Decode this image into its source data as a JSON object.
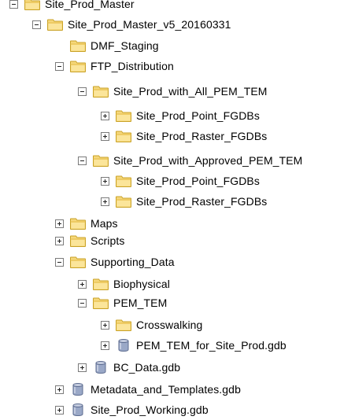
{
  "colors": {
    "text": "#000000",
    "toggle_border": "#7a7a7a",
    "folder_fill": "#f5d77a",
    "folder_stroke": "#c9a227",
    "database_fill": "#9aa8c7",
    "database_stroke": "#5c6b8f"
  },
  "tree": [
    {
      "label": "Site_Prod_Master",
      "icon": "folder-icon",
      "expander": "minus"
    },
    {
      "label": "Site_Prod_Master_v5_20160331",
      "icon": "folder-icon",
      "expander": "minus"
    },
    {
      "label": "DMF_Staging",
      "icon": "folder-icon",
      "expander": "none"
    },
    {
      "label": "FTP_Distribution",
      "icon": "folder-icon",
      "expander": "minus"
    },
    {
      "label": "Site_Prod_with_All_PEM_TEM",
      "icon": "folder-icon",
      "expander": "minus"
    },
    {
      "label": "Site_Prod_Point_FGDBs",
      "icon": "folder-icon",
      "expander": "plus"
    },
    {
      "label": "Site_Prod_Raster_FGDBs",
      "icon": "folder-icon",
      "expander": "plus"
    },
    {
      "label": "Site_Prod_with_Approved_PEM_TEM",
      "icon": "folder-icon",
      "expander": "minus"
    },
    {
      "label": "Site_Prod_Point_FGDBs",
      "icon": "folder-icon",
      "expander": "plus"
    },
    {
      "label": "Site_Prod_Raster_FGDBs",
      "icon": "folder-icon",
      "expander": "plus"
    },
    {
      "label": "Maps",
      "icon": "folder-icon",
      "expander": "plus"
    },
    {
      "label": "Scripts",
      "icon": "folder-icon",
      "expander": "plus"
    },
    {
      "label": "Supporting_Data",
      "icon": "folder-icon",
      "expander": "minus"
    },
    {
      "label": "Biophysical",
      "icon": "folder-icon",
      "expander": "plus"
    },
    {
      "label": "PEM_TEM",
      "icon": "folder-icon",
      "expander": "minus"
    },
    {
      "label": "Crosswalking",
      "icon": "folder-icon",
      "expander": "plus"
    },
    {
      "label": "PEM_TEM_for_Site_Prod.gdb",
      "icon": "database-icon",
      "expander": "plus"
    },
    {
      "label": "BC_Data.gdb",
      "icon": "database-icon",
      "expander": "plus"
    },
    {
      "label": "Metadata_and_Templates.gdb",
      "icon": "database-icon",
      "expander": "plus"
    },
    {
      "label": "Site_Prod_Working.gdb",
      "icon": "database-icon",
      "expander": "plus"
    }
  ]
}
